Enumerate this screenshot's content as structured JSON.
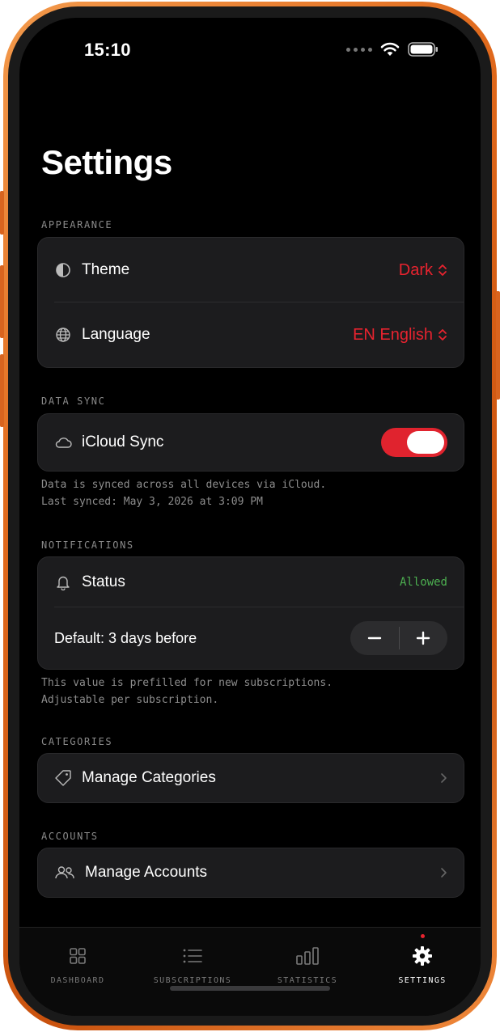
{
  "status_bar": {
    "time": "15:10"
  },
  "page": {
    "title": "Settings"
  },
  "appearance": {
    "section_label": "APPEARANCE",
    "theme": {
      "label": "Theme",
      "value": "Dark"
    },
    "language": {
      "label": "Language",
      "value": "EN English"
    }
  },
  "data_sync": {
    "section_label": "DATA SYNC",
    "icloud": {
      "label": "iCloud Sync",
      "enabled": true
    },
    "footnote_line1": "Data is synced across all devices via iCloud.",
    "footnote_line2": "Last synced: May 3, 2026 at 3:09 PM"
  },
  "notifications": {
    "section_label": "NOTIFICATIONS",
    "status": {
      "label": "Status",
      "value": "Allowed"
    },
    "default": {
      "label": "Default: 3 days before",
      "minus": "−",
      "plus": "+"
    },
    "footnote_line1": "This value is prefilled for new subscriptions.",
    "footnote_line2": "Adjustable per subscription."
  },
  "categories": {
    "section_label": "CATEGORIES",
    "manage_label": "Manage Categories"
  },
  "accounts": {
    "section_label": "ACCOUNTS",
    "manage_label": "Manage Accounts"
  },
  "tabbar": {
    "items": [
      {
        "label": "DASHBOARD",
        "icon": "grid-icon"
      },
      {
        "label": "SUBSCRIPTIONS",
        "icon": "list-icon"
      },
      {
        "label": "STATISTICS",
        "icon": "bar-chart-icon"
      },
      {
        "label": "SETTINGS",
        "icon": "gear-icon",
        "active": true
      }
    ]
  },
  "colors": {
    "accent": "#e8232f",
    "success": "#4caf50",
    "card": "#1c1c1e",
    "frame": "#e0691c"
  }
}
